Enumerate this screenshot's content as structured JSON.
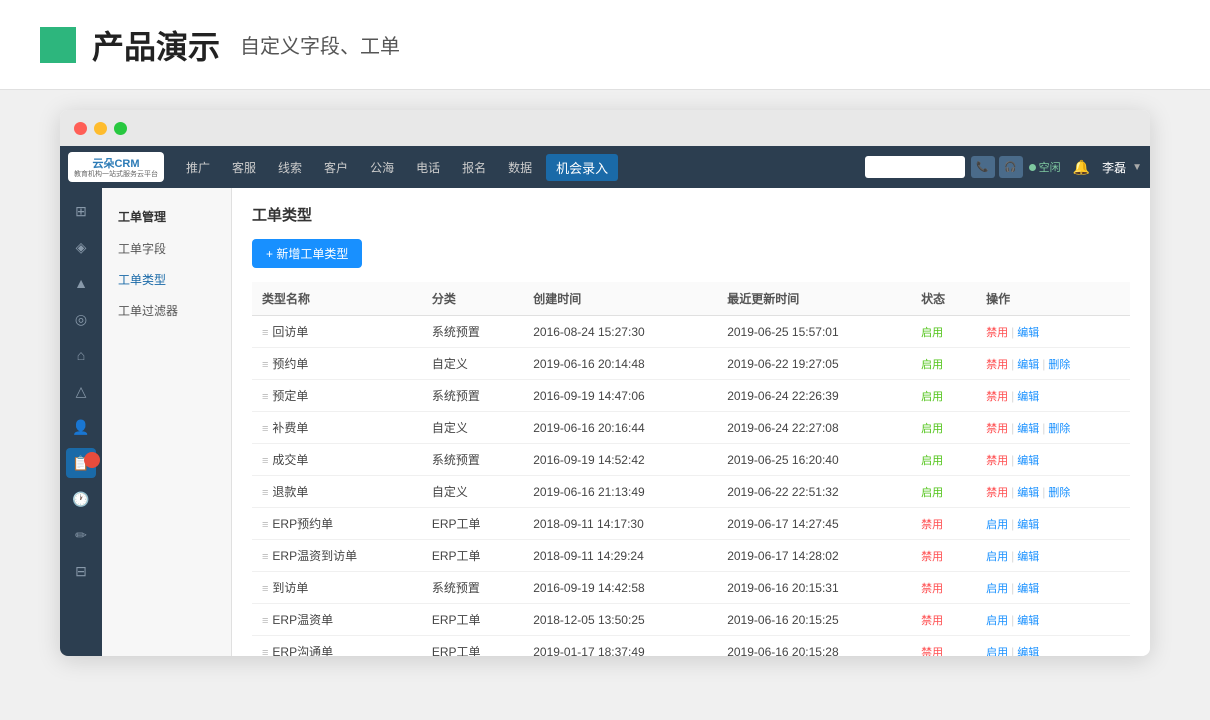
{
  "banner": {
    "title": "产品演示",
    "subtitle": "自定义字段、工单"
  },
  "nav": {
    "logo_top": "云朵CRM",
    "logo_sub": "教育机构一站式服务云平台",
    "logo_url": "www.yunduocrm.com",
    "items": [
      "推广",
      "客服",
      "线索",
      "客户",
      "公海",
      "电话",
      "报名",
      "数据"
    ],
    "active_item": "机会录入",
    "search_placeholder": "",
    "status": "空闲",
    "user": "李磊"
  },
  "sidebar_icons": [
    {
      "name": "home-icon",
      "symbol": "⊞"
    },
    {
      "name": "shield-icon",
      "symbol": "◈"
    },
    {
      "name": "chart-icon",
      "symbol": "▲"
    },
    {
      "name": "location-icon",
      "symbol": "◎"
    },
    {
      "name": "building-icon",
      "symbol": "⌂"
    },
    {
      "name": "alert-icon",
      "symbol": "△"
    },
    {
      "name": "user-icon",
      "symbol": "👤"
    },
    {
      "name": "document-icon",
      "symbol": "📋",
      "active": true
    },
    {
      "name": "clock-icon",
      "symbol": "🕐"
    },
    {
      "name": "tag-icon",
      "symbol": "✏"
    },
    {
      "name": "folder-icon",
      "symbol": "⊟"
    }
  ],
  "left_menu": {
    "section": "工单管理",
    "items": [
      {
        "label": "工单字段",
        "active": false
      },
      {
        "label": "工单类型",
        "active": true
      },
      {
        "label": "工单过滤器",
        "active": false
      }
    ]
  },
  "page": {
    "title": "工单类型",
    "add_button": "+ 新增工单类型"
  },
  "table": {
    "headers": [
      "类型名称",
      "分类",
      "创建时间",
      "最近更新时间",
      "状态",
      "操作"
    ],
    "rows": [
      {
        "name": "回访单",
        "category": "系统预置",
        "created": "2016-08-24 15:27:30",
        "updated": "2019-06-25 15:57:01",
        "status": "启用",
        "status_type": "enabled",
        "actions": [
          "禁用",
          "编辑"
        ]
      },
      {
        "name": "预约单",
        "category": "自定义",
        "created": "2019-06-16 20:14:48",
        "updated": "2019-06-22 19:27:05",
        "status": "启用",
        "status_type": "enabled",
        "actions": [
          "禁用",
          "编辑",
          "删除"
        ]
      },
      {
        "name": "预定单",
        "category": "系统预置",
        "created": "2016-09-19 14:47:06",
        "updated": "2019-06-24 22:26:39",
        "status": "启用",
        "status_type": "enabled",
        "actions": [
          "禁用",
          "编辑"
        ]
      },
      {
        "name": "补费单",
        "category": "自定义",
        "created": "2019-06-16 20:16:44",
        "updated": "2019-06-24 22:27:08",
        "status": "启用",
        "status_type": "enabled",
        "actions": [
          "禁用",
          "编辑",
          "删除"
        ]
      },
      {
        "name": "成交单",
        "category": "系统预置",
        "created": "2016-09-19 14:52:42",
        "updated": "2019-06-25 16:20:40",
        "status": "启用",
        "status_type": "enabled",
        "actions": [
          "禁用",
          "编辑"
        ]
      },
      {
        "name": "退款单",
        "category": "自定义",
        "created": "2019-06-16 21:13:49",
        "updated": "2019-06-22 22:51:32",
        "status": "启用",
        "status_type": "enabled",
        "actions": [
          "禁用",
          "编辑",
          "删除"
        ]
      },
      {
        "name": "ERP预约单",
        "category": "ERP工单",
        "created": "2018-09-11 14:17:30",
        "updated": "2019-06-17 14:27:45",
        "status": "禁用",
        "status_type": "disabled",
        "actions": [
          "启用",
          "编辑"
        ]
      },
      {
        "name": "ERP温资到访单",
        "category": "ERP工单",
        "created": "2018-09-11 14:29:24",
        "updated": "2019-06-17 14:28:02",
        "status": "禁用",
        "status_type": "disabled",
        "actions": [
          "启用",
          "编辑"
        ]
      },
      {
        "name": "到访单",
        "category": "系统预置",
        "created": "2016-09-19 14:42:58",
        "updated": "2019-06-16 20:15:31",
        "status": "禁用",
        "status_type": "disabled",
        "actions": [
          "启用",
          "编辑"
        ]
      },
      {
        "name": "ERP温资单",
        "category": "ERP工单",
        "created": "2018-12-05 13:50:25",
        "updated": "2019-06-16 20:15:25",
        "status": "禁用",
        "status_type": "disabled",
        "actions": [
          "启用",
          "编辑"
        ]
      },
      {
        "name": "ERP沟通单",
        "category": "ERP工单",
        "created": "2019-01-17 18:37:49",
        "updated": "2019-06-16 20:15:28",
        "status": "禁用",
        "status_type": "disabled",
        "actions": [
          "启用",
          "编辑"
        ]
      }
    ]
  }
}
